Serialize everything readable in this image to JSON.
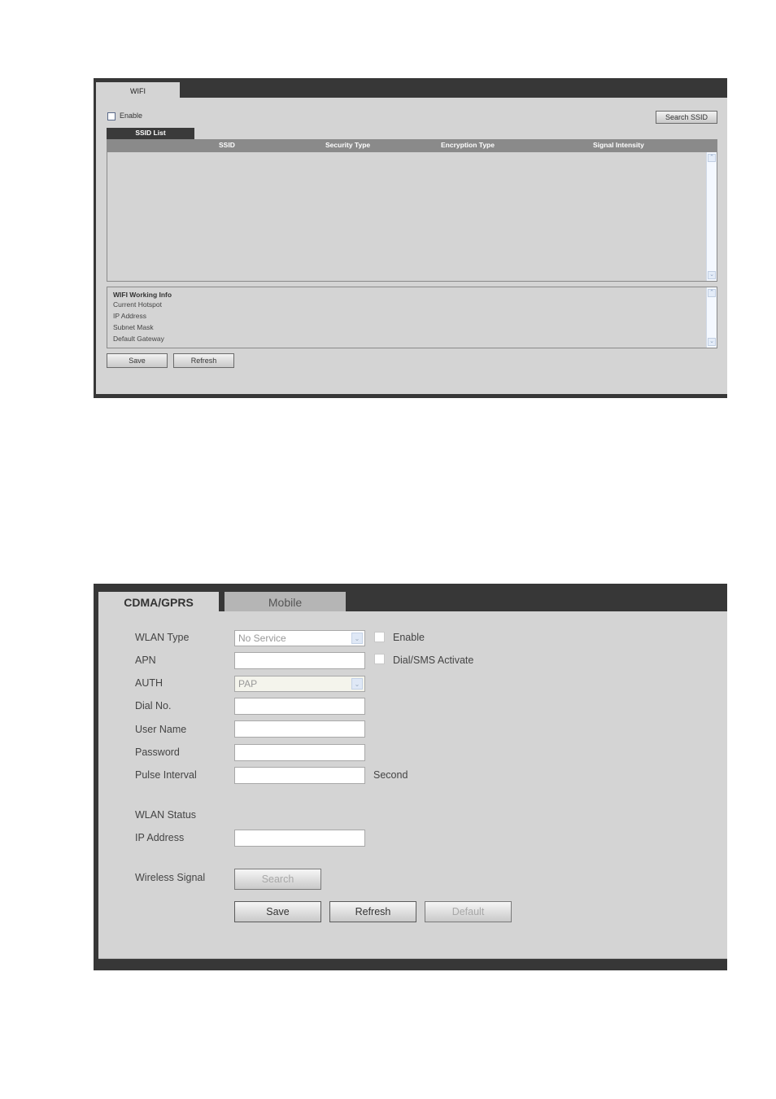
{
  "wifi_panel": {
    "tab_label": "WIFI",
    "enable_label": "Enable",
    "enable_checked": false,
    "search_ssid_button": "Search SSID",
    "ssid_list_tab": "SSID List",
    "table_columns": [
      "SSID",
      "Security Type",
      "Encryption Type",
      "Signal Intensity"
    ],
    "table_rows": [],
    "working_info": {
      "title": "WIFI Working Info",
      "lines": [
        "Current Hotspot",
        "IP Address",
        "Subnet Mask",
        "Default Gateway"
      ]
    },
    "save_button": "Save",
    "refresh_button": "Refresh"
  },
  "cdma_panel": {
    "tabs": [
      {
        "label": "CDMA/GPRS",
        "active": true
      },
      {
        "label": "Mobile",
        "active": false
      }
    ],
    "fields": {
      "wlan_type": {
        "label": "WLAN Type",
        "value": "No Service"
      },
      "apn": {
        "label": "APN",
        "value": ""
      },
      "auth": {
        "label": "AUTH",
        "value": "PAP"
      },
      "dial_no": {
        "label": "Dial No.",
        "value": ""
      },
      "user_name": {
        "label": "User Name",
        "value": ""
      },
      "password": {
        "label": "Password",
        "value": ""
      },
      "pulse_interval": {
        "label": "Pulse Interval",
        "value": "",
        "unit": "Second"
      }
    },
    "enable_label": "Enable",
    "enable_checked": false,
    "dial_sms_label": "Dial/SMS Activate",
    "dial_sms_checked": false,
    "wlan_status_label": "WLAN Status",
    "ip_address": {
      "label": "IP Address",
      "value": ""
    },
    "wireless_signal_label": "Wireless Signal",
    "search_button": "Search",
    "save_button": "Save",
    "refresh_button": "Refresh",
    "default_button": "Default"
  }
}
